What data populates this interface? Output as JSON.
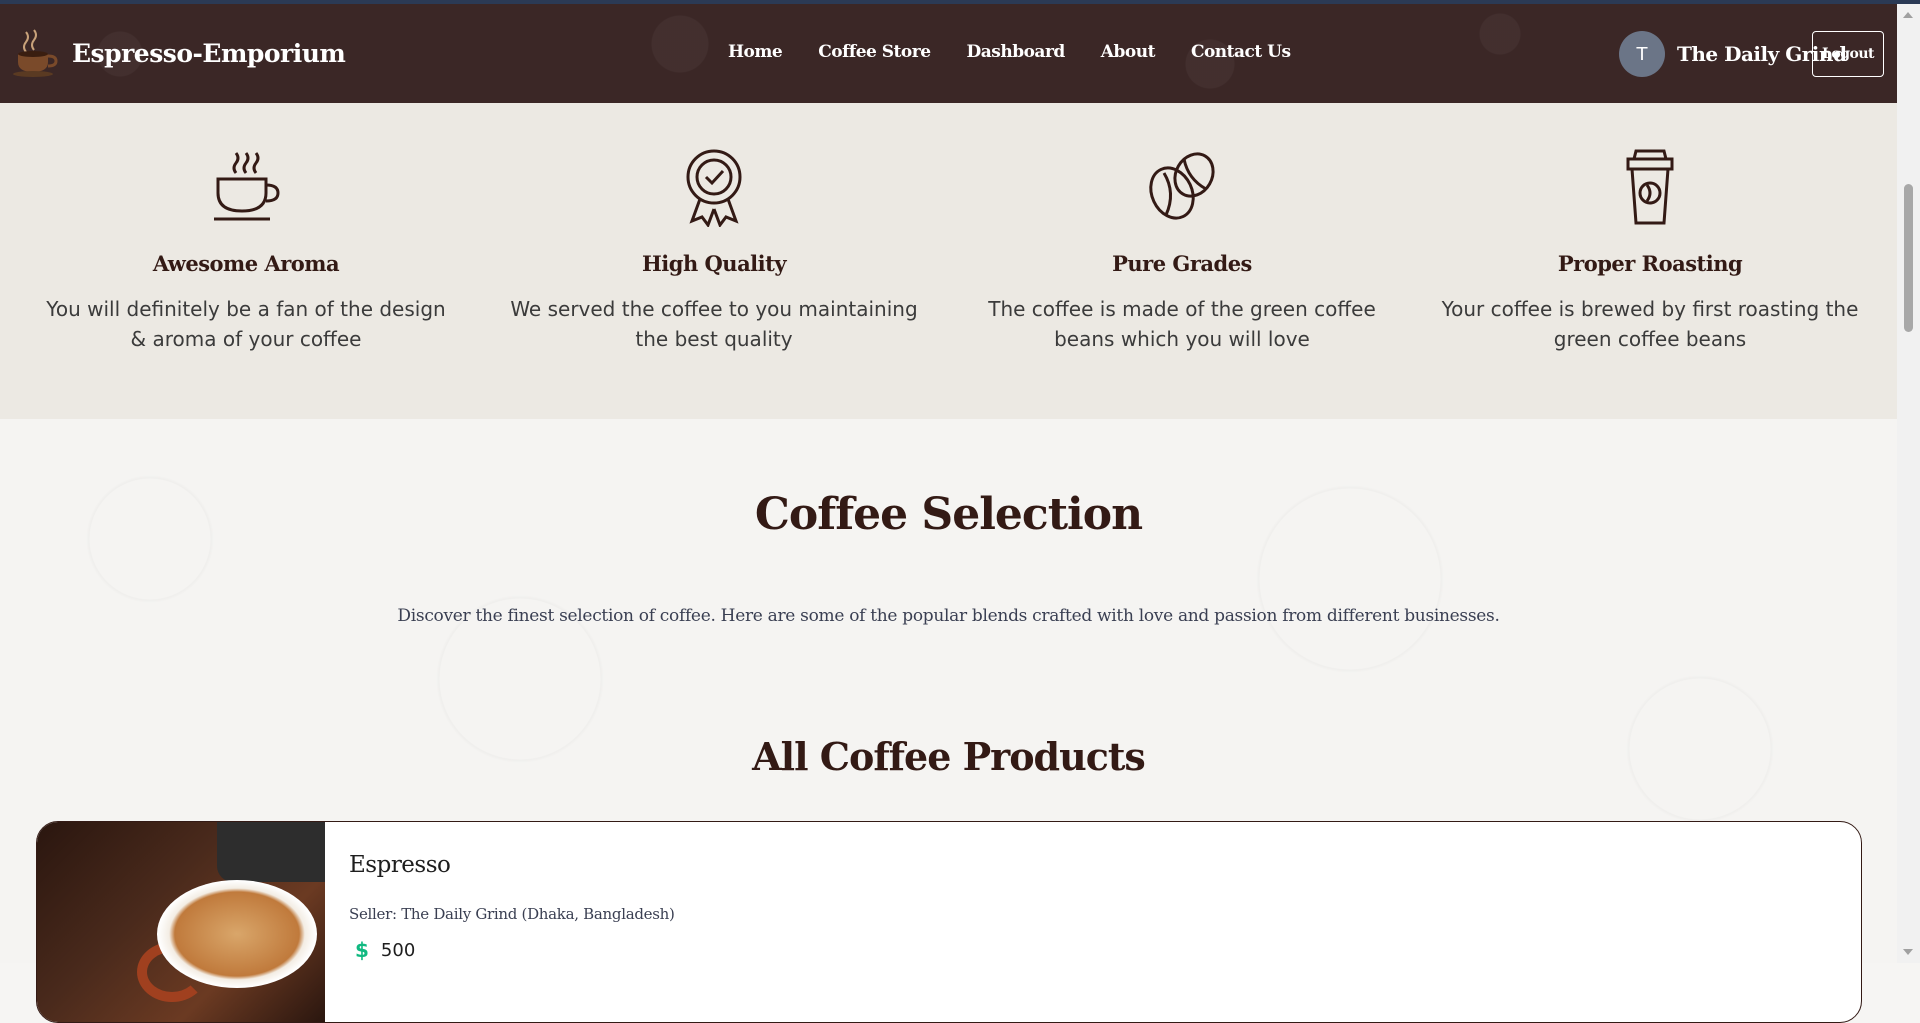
{
  "navbar": {
    "brand": "Espresso-Emporium",
    "links": [
      "Home",
      "Coffee Store",
      "Dashboard",
      "About",
      "Contact Us"
    ],
    "user": {
      "initial": "T",
      "name": "The Daily Grind"
    },
    "logout_label": "Logout"
  },
  "features": [
    {
      "icon": "coffee-cup-icon",
      "title": "Awesome Aroma",
      "text": "You will definitely be a fan of the design & aroma of your coffee"
    },
    {
      "icon": "quality-badge-icon",
      "title": "High Quality",
      "text": "We served the coffee to you maintaining the best quality"
    },
    {
      "icon": "coffee-beans-icon",
      "title": "Pure Grades",
      "text": "The coffee is made of the green coffee beans which you will love"
    },
    {
      "icon": "takeaway-cup-icon",
      "title": "Proper Roasting",
      "text": "Your coffee is brewed by first roasting the green coffee beans"
    }
  ],
  "selection": {
    "title": "Coffee Selection",
    "description": "Discover the finest selection of coffee. Here are some of the popular blends crafted with love and passion from different businesses.",
    "products_title": "All Coffee Products"
  },
  "products": [
    {
      "name": "Espresso",
      "seller": "Seller: The Daily Grind (Dhaka, Bangladesh)",
      "currency_icon": "dollar-icon",
      "price": "500"
    }
  ],
  "colors": {
    "navbar": "#3b2726",
    "features_bg": "#ece9e3",
    "accent_text": "#331a15",
    "price_icon": "#10b981"
  }
}
